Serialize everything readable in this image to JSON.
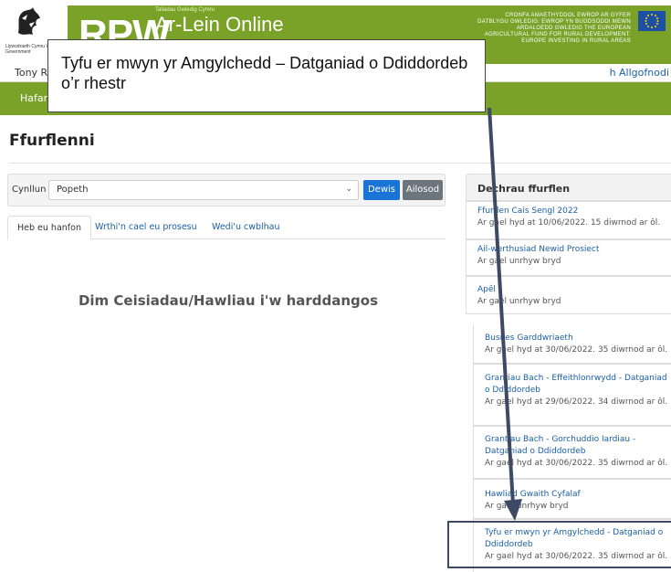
{
  "header": {
    "gov_text": "Llywodraeth Cymru Welsh Government",
    "brand": "RPW",
    "brand_sub_small": "Taliadau Gwledig Cymru",
    "brand_sub": "Ar-Lein Online",
    "fund_text": "CRONFA AMAETHYDDOL EWROP AR GYFER DATBLYGU GWLEDIG: EWROP YN BUDDSODDI MEWN ARDALOEDD GWLEDIG THE EUROPEAN AGRICULTURAL FUND FOR RURAL DEVELOPMENT: EUROPE INVESTING IN RURAL AREAS"
  },
  "userbar": {
    "user_name": "Tony Ri",
    "logout_label": "h Allgofnodi"
  },
  "nav": {
    "home_label": "Hafan"
  },
  "page": {
    "title": "Ffurflenni",
    "scheme_label": "Cynllun",
    "scheme_value": "Popeth",
    "choose_label": "Dewis",
    "reset_label": "Ailosod",
    "tabs": [
      {
        "label": "Heb eu hanfon"
      },
      {
        "label": "Wrthi'n cael eu prosesu"
      },
      {
        "label": "Wedi'u cwblhau"
      }
    ],
    "empty_message": "Dim Ceisiadau/Hawliau i'w harddangos"
  },
  "forms": {
    "heading": "Dechrau ffurflen",
    "items": [
      {
        "title": "Ffurflen Cais Sengl 2022",
        "availability": "Ar gael hyd at 10/06/2022. 15 diwrnod ar ôl."
      },
      {
        "title": "Ail-werthusiad Newid Prosiect",
        "availability": "Ar gael unrhyw bryd"
      },
      {
        "title": "Apêl",
        "availability": "Ar gael unrhyw bryd"
      },
      {
        "title": "Busnes Garddwriaeth",
        "availability": "Ar gael hyd at 30/06/2022. 35 diwrnod ar ôl."
      },
      {
        "title": "Grantiau Bach - Effeithlonrwydd - Datganiad o Ddiddordeb",
        "availability": "Ar gael hyd at 29/06/2022. 34 diwrnod ar ôl."
      },
      {
        "title": "Grantiau Bach - Gorchuddio Iardiau - Datganiad o Ddiddordeb",
        "availability": "Ar gael hyd at 30/06/2022. 35 diwrnod ar ôl."
      },
      {
        "title": "Hawliad Gwaith Cyfalaf",
        "availability": "Ar gael unrhyw bryd"
      },
      {
        "title": "Tyfu er mwyn yr Amgylchedd - Datganiad o Ddiddordeb",
        "availability": "Ar gael hyd at 30/06/2022. 35 diwrnod ar ôl."
      }
    ]
  },
  "callout": {
    "text": "Tyfu er mwyn yr Amgylchedd – Datganiad o Ddiddordeb o’r rhestr"
  },
  "colors": {
    "brand_green": "#7aa228",
    "link_blue": "#1a5fa8",
    "primary_button": "#1a73d6",
    "secondary_button": "#6c757d",
    "arrow": "#3e4a63",
    "eu_blue": "#1d4fa5"
  },
  "icons": {
    "gov_logo": "welsh-dragon-icon",
    "eu_flag": "eu-flag-icon",
    "select_chevron": "chevron-down-icon"
  }
}
